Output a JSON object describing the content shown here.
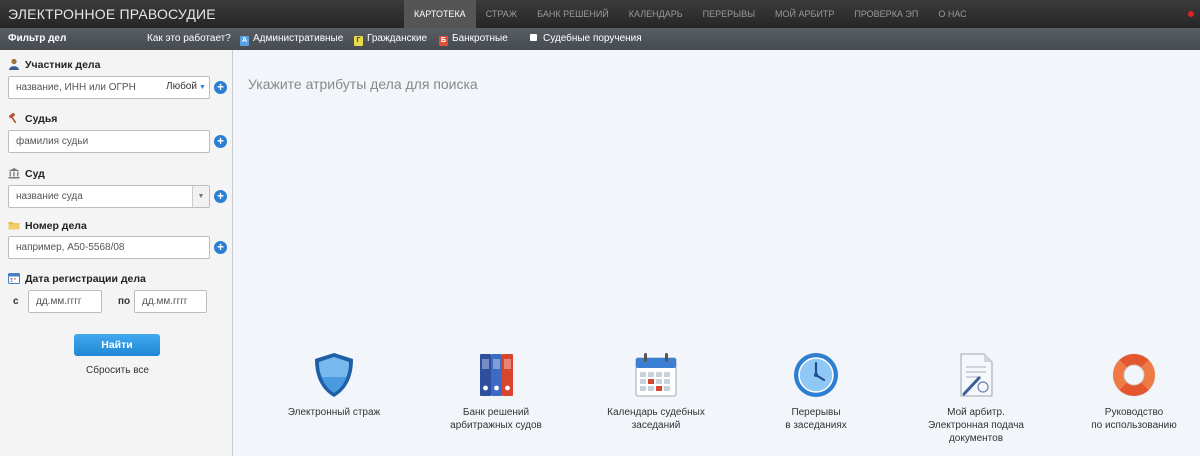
{
  "header": {
    "brand": "ЭЛЕКТРОННОЕ ПРАВОСУДИЕ",
    "nav": [
      "КАРТОТЕКА",
      "СТРАЖ",
      "БАНК РЕШЕНИЙ",
      "КАЛЕНДАРЬ",
      "ПЕРЕРЫВЫ",
      "МОЙ АРБИТР",
      "ПРОВЕРКА ЭП",
      "О НАС"
    ],
    "active_nav": "КАРТОТЕКА"
  },
  "filterbar": {
    "title": "Фильтр дел",
    "how": "Как это работает?",
    "types": {
      "admin": "Административные",
      "civil": "Гражданские",
      "bankrupt": "Банкротные",
      "orders": "Судебные поручения"
    }
  },
  "sidebar": {
    "participant": {
      "label": "Участник дела",
      "placeholder": "название, ИНН или ОГРН",
      "role": "Любой"
    },
    "judge": {
      "label": "Судья",
      "placeholder": "фамилия судьи"
    },
    "court": {
      "label": "Суд",
      "placeholder": "название суда"
    },
    "case_number": {
      "label": "Номер дела",
      "placeholder": "например, А50-5568/08"
    },
    "reg_date": {
      "label": "Дата регистрации дела",
      "from_label": "с",
      "to_label": "по",
      "from_placeholder": "дд.мм.гггг",
      "to_placeholder": "дд.мм.гггг"
    },
    "find_button": "Найти",
    "reset_link": "Сбросить все"
  },
  "main": {
    "prompt": "Укажите атрибуты дела для поиска",
    "tiles": [
      {
        "label": "Электронный страж",
        "icon": "shield-icon"
      },
      {
        "label": "Банк решений\nарбитражных судов",
        "icon": "binders-icon"
      },
      {
        "label": "Календарь судебных\nзаседаний",
        "icon": "calendar-icon"
      },
      {
        "label": "Перерывы\nв заседаниях",
        "icon": "clock-icon"
      },
      {
        "label": "Мой арбитр.\nЭлектронная подача\nдокументов",
        "icon": "document-pen-icon"
      },
      {
        "label": "Руководство\nпо использованию",
        "icon": "lifebuoy-icon"
      }
    ]
  },
  "colors": {
    "accent": "#2b7fd3",
    "topbar": "#2e2e2e",
    "filterbar": "#50565b",
    "alert_dot": "#dd2222"
  }
}
